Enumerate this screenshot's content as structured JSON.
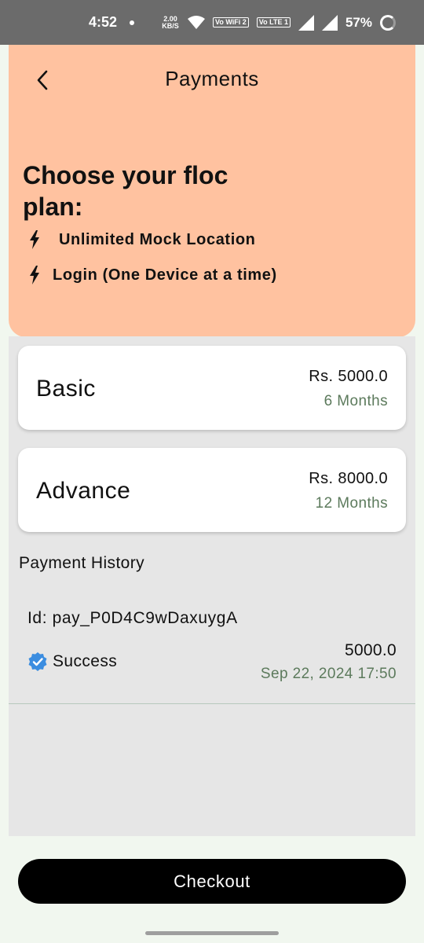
{
  "status_bar": {
    "time": "4:52",
    "net_speed": "2.00",
    "net_unit": "KB/S",
    "wifi_badge": "Vo WiFi 2",
    "lte_badge": "Vo LTE 1",
    "battery": "57%"
  },
  "header": {
    "title": "Payments",
    "plan_heading": "Choose your floc plan:",
    "features": [
      "Unlimited Mock Location",
      "Login (One Device at a time)"
    ]
  },
  "plans": [
    {
      "name": "Basic",
      "price": "Rs. 5000.0",
      "duration": "6 Months"
    },
    {
      "name": "Advance",
      "price": "Rs. 8000.0",
      "duration": "12 Months"
    }
  ],
  "history": {
    "title": "Payment History",
    "items": [
      {
        "id": "Id: pay_P0D4C9wDaxuygA",
        "status": "Success",
        "amount": "5000.0",
        "date": "Sep 22, 2024 17:50"
      }
    ]
  },
  "checkout_label": "Checkout",
  "colors": {
    "header_bg": "#ffc2a0",
    "panel_bg": "#e6e6e6",
    "page_bg": "#f1f7ef",
    "secondary_text": "#5c7a5c",
    "verified_blue": "#3b8de0"
  }
}
